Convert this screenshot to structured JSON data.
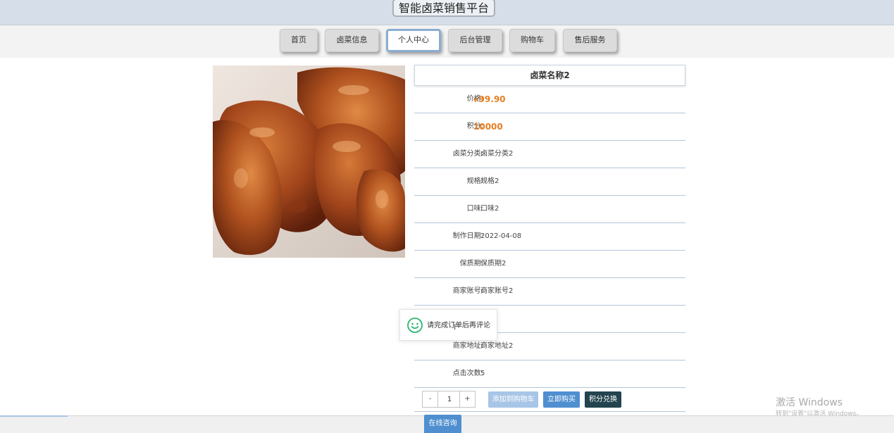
{
  "header": {
    "title": "智能卤菜销售平台"
  },
  "nav": {
    "items": [
      {
        "label": "首页"
      },
      {
        "label": "卤菜信息"
      },
      {
        "label": "个人中心"
      },
      {
        "label": "后台管理"
      },
      {
        "label": "购物车"
      },
      {
        "label": "售后服务"
      }
    ],
    "active_index": 2
  },
  "product": {
    "name": "卤菜名称2",
    "price_label": "价格:",
    "currency": "¥",
    "price": "99.90",
    "points_label": "积分:",
    "points": "10000",
    "fields": [
      {
        "label": "卤菜分类:",
        "value": "卤菜分类2"
      },
      {
        "label": "规格:",
        "value": "规格2"
      },
      {
        "label": "口味:",
        "value": "口味2"
      },
      {
        "label": "制作日期:",
        "value": "2022-04-08"
      },
      {
        "label": "保质期:",
        "value": "保质期2"
      },
      {
        "label": "商家账号:",
        "value": "商家账号2"
      },
      {
        "label": "",
        "value": "称2"
      },
      {
        "label": "商家地址:",
        "value": "商家地址2"
      },
      {
        "label": "点击次数:",
        "value": "5"
      }
    ]
  },
  "purchase": {
    "minus": "-",
    "quantity": "1",
    "plus": "+",
    "add_to_cart": "添加到购物车",
    "buy_now": "立即购买",
    "exchange": "积分兑换"
  },
  "toast": {
    "message": "请完成订单后再评论",
    "icon": "smile-icon"
  },
  "consult": {
    "label": "在线咨询"
  },
  "watermark": {
    "line1": "激活 Windows",
    "line2": "转到\"设置\"以激活 Windows。"
  },
  "colors": {
    "accent": "#4f8fd0",
    "price": "#e67e22",
    "dark_button": "#23444f",
    "nav_active_border": "#8aaed1"
  }
}
